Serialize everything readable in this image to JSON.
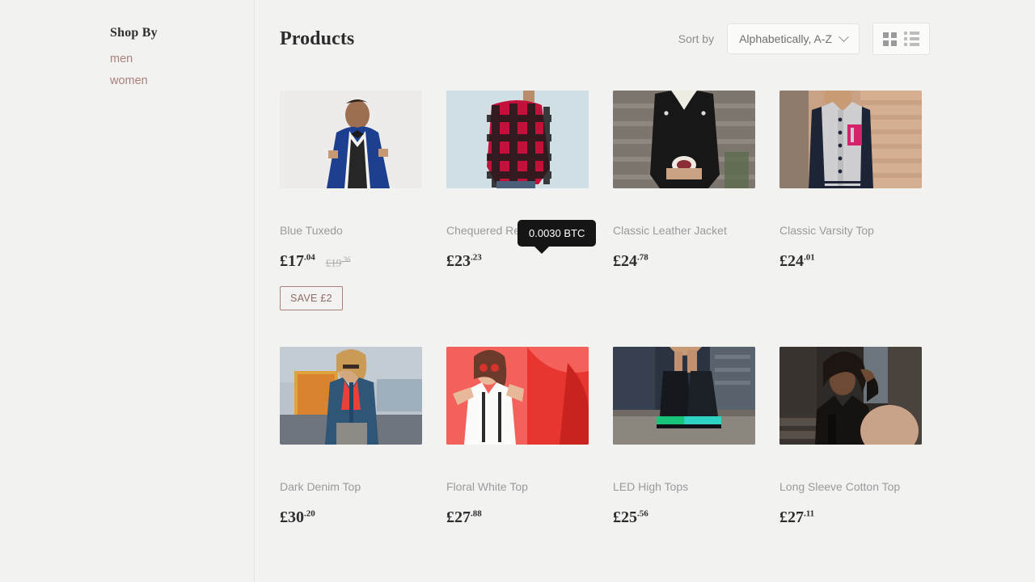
{
  "sidebar": {
    "title": "Shop By",
    "links": [
      {
        "label": "men"
      },
      {
        "label": "women"
      }
    ]
  },
  "toolbar": {
    "page_title": "Products",
    "sort_label": "Sort by",
    "sort_value": "Alphabetically, A-Z",
    "sort_options": [
      "Alphabetically, A-Z"
    ],
    "grid_view_icon": "grid-view-icon",
    "list_view_icon": "list-view-icon",
    "chevron_icon": "chevron-down-icon"
  },
  "tooltip": {
    "text": "0.0030 BTC"
  },
  "colors": {
    "accent": "#a9807b",
    "background": "#f2f2f1",
    "title": "#2d2d2d",
    "muted": "#9a9a9a",
    "tooltip_bg": "#151515"
  },
  "products": [
    {
      "title": "Blue Tuxedo",
      "price_whole": "£17",
      "price_cents": ".04",
      "compare_whole": "£19",
      "compare_cents": ".36",
      "badge": "SAVE £2",
      "image_name": "blue-tuxedo-photo"
    },
    {
      "title": "Chequered Red Shirt",
      "price_whole": "£23",
      "price_cents": ".23",
      "compare_whole": "",
      "compare_cents": "",
      "badge": "",
      "image_name": "chequered-red-shirt-photo"
    },
    {
      "title": "Classic Leather Jacket",
      "price_whole": "£24",
      "price_cents": ".78",
      "compare_whole": "",
      "compare_cents": "",
      "badge": "",
      "image_name": "classic-leather-jacket-photo"
    },
    {
      "title": "Classic Varsity Top",
      "price_whole": "£24",
      "price_cents": ".01",
      "compare_whole": "",
      "compare_cents": "",
      "badge": "",
      "image_name": "classic-varsity-top-photo"
    },
    {
      "title": "Dark Denim Top",
      "price_whole": "£30",
      "price_cents": ".20",
      "compare_whole": "",
      "compare_cents": "",
      "badge": "",
      "image_name": "dark-denim-top-photo"
    },
    {
      "title": "Floral White Top",
      "price_whole": "£27",
      "price_cents": ".88",
      "compare_whole": "",
      "compare_cents": "",
      "badge": "",
      "image_name": "floral-white-top-photo"
    },
    {
      "title": "LED High Tops",
      "price_whole": "£25",
      "price_cents": ".56",
      "compare_whole": "",
      "compare_cents": "",
      "badge": "",
      "image_name": "led-high-tops-photo"
    },
    {
      "title": "Long Sleeve Cotton Top",
      "price_whole": "£27",
      "price_cents": ".11",
      "compare_whole": "",
      "compare_cents": "",
      "badge": "",
      "image_name": "long-sleeve-cotton-top-photo"
    }
  ]
}
